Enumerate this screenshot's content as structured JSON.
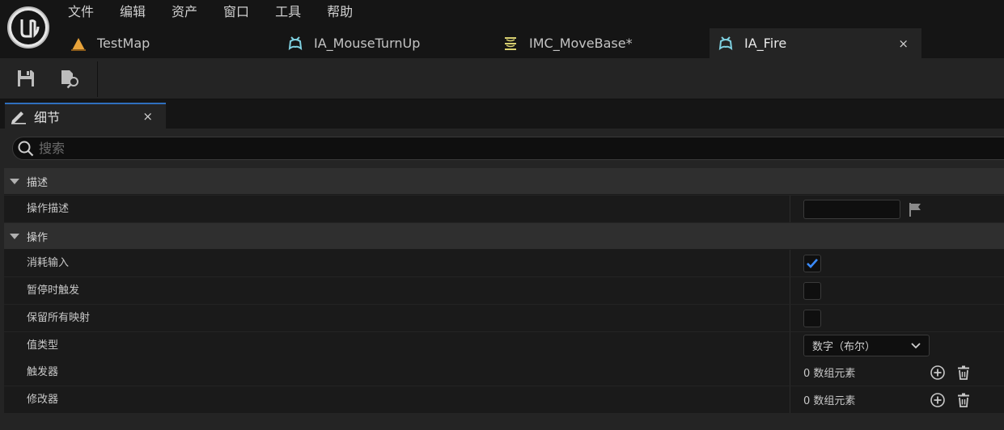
{
  "menu": [
    "文件",
    "编辑",
    "资产",
    "窗口",
    "工具",
    "帮助"
  ],
  "tabs": [
    {
      "label": "TestMap",
      "icon": "level-icon"
    },
    {
      "label": "IA_MouseTurnUp",
      "icon": "input-action-icon"
    },
    {
      "label": "IMC_MoveBase*",
      "icon": "input-mapping-context-icon"
    },
    {
      "label": "IA_Fire",
      "icon": "input-action-icon",
      "active": true,
      "close": "×"
    }
  ],
  "toolbar": {
    "save": "save-icon",
    "browse": "browse-asset-icon"
  },
  "panel": {
    "title": "细节",
    "close": "×",
    "search_placeholder": "搜索",
    "sections": {
      "description": {
        "label": "描述",
        "rows": [
          {
            "label": "操作描述",
            "value": ""
          }
        ]
      },
      "action": {
        "label": "操作",
        "consume_input": {
          "label": "消耗输入",
          "checked": true
        },
        "trigger_when_paused": {
          "label": "暂停时触发",
          "checked": false
        },
        "reserve_all_mappings": {
          "label": "保留所有映射",
          "checked": false
        },
        "value_type": {
          "label": "值类型",
          "value": "数字（布尔）"
        },
        "triggers": {
          "label": "触发器",
          "value": "0 数组元素"
        },
        "modifiers": {
          "label": "修改器",
          "value": "0 数组元素"
        }
      }
    }
  },
  "colors": {
    "accent": "#2f6fbe",
    "check": "#3a8bff",
    "level_icon": "#e8a33a",
    "ia_icon": "#7fd0e0",
    "imc_icon": "#d8d070"
  }
}
